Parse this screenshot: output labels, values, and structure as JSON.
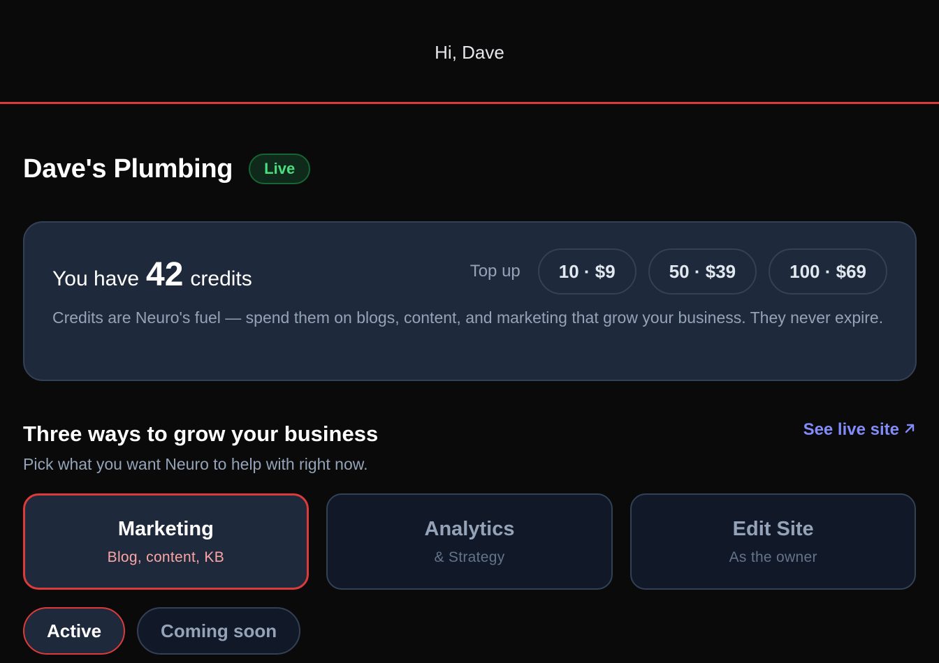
{
  "header": {
    "greeting": "Hi, Dave"
  },
  "site": {
    "name": "Dave's Plumbing",
    "status": "Live"
  },
  "credits": {
    "prefix": "You have",
    "amount": "42",
    "suffix": "credits",
    "topup_label": "Top up",
    "packs": [
      {
        "label": "10 · $9"
      },
      {
        "label": "50 · $39"
      },
      {
        "label": "100 · $69"
      }
    ],
    "description": "Credits are Neuro's fuel — spend them on blogs, content, and marketing that grow your business. They never expire."
  },
  "section": {
    "title": "Three ways to grow your business",
    "subtitle": "Pick what you want Neuro to help with right now.",
    "live_link": "See live site",
    "live_link_icon": "arrow-up-right-icon"
  },
  "options": [
    {
      "title": "Marketing",
      "subtitle": "Blog, content, KB"
    },
    {
      "title": "Analytics",
      "subtitle": "& Strategy"
    },
    {
      "title": "Edit Site",
      "subtitle": "As the owner"
    }
  ],
  "status_tabs": [
    {
      "label": "Active"
    },
    {
      "label": "Coming soon"
    }
  ],
  "colors": {
    "accent": "#dc3b3b",
    "live_green": "#4ade80",
    "link": "#818cf8",
    "card_bg": "#1e293b"
  }
}
